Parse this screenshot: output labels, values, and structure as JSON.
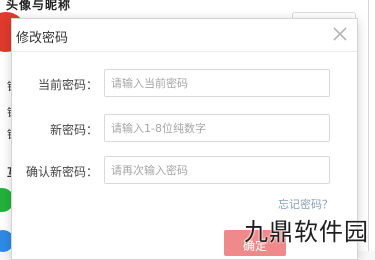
{
  "background": {
    "title": "头像与昵称",
    "left_chars": [
      "锁",
      "锁",
      "锁",
      "互"
    ]
  },
  "modal": {
    "title": "修改密码",
    "close_icon": "close-icon",
    "fields": [
      {
        "label": "当前密码：",
        "placeholder": "请输入当前密码",
        "value": ""
      },
      {
        "label": "新密码：",
        "placeholder": "请输入1-8位纯数字",
        "value": ""
      },
      {
        "label": "确认新密码：",
        "placeholder": "请再次输入密码",
        "value": ""
      }
    ],
    "forgot_label": "忘记密码？",
    "confirm_label": "确定"
  },
  "watermark": "九鼎软件园",
  "colors": {
    "accent": "#f08a8a",
    "avatar": "#e03a2e",
    "green": "#23b33b",
    "blue": "#2f8be6",
    "link": "#8aa1b6"
  }
}
